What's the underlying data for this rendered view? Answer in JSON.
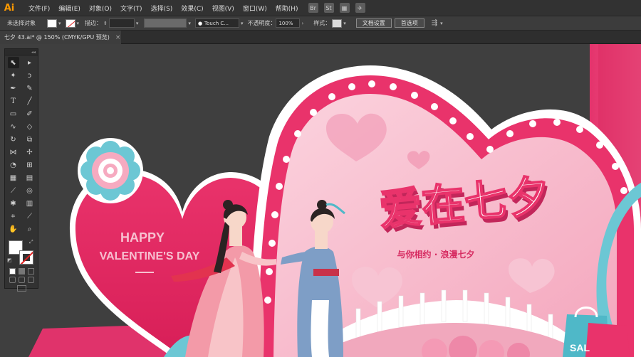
{
  "app": {
    "logo": "Ai"
  },
  "menu": [
    "文件(F)",
    "编辑(E)",
    "对象(O)",
    "文字(T)",
    "选择(S)",
    "效果(C)",
    "视图(V)",
    "窗口(W)",
    "帮助(H)"
  ],
  "menubar_icons": [
    "Br",
    "St",
    "▦",
    "✈"
  ],
  "controlbar": {
    "selection_status": "未选择对象",
    "stroke_label": "描边：",
    "brush_name": "Touch C...",
    "opacity_label": "不透明度：",
    "opacity_value": "100%",
    "style_label": "样式：",
    "doc_setup_button": "文档设置",
    "preferences_button": "首选项"
  },
  "tab": {
    "title": "七夕 43.ai* @ 150% (CMYK/GPU 预览)",
    "close": "×"
  },
  "artwork": {
    "headline": "爱在七夕",
    "subtitle": "与你相约 · 浪漫七夕",
    "happy_line1": "HAPPY",
    "happy_line2": "VALENTINE'S DAY",
    "bag_text": "SAL"
  },
  "colors": {
    "canvas_dark": "#404040",
    "pink_deep": "#e9336b",
    "pink_light": "#f7b9cb",
    "teal": "#6cc7d4"
  }
}
